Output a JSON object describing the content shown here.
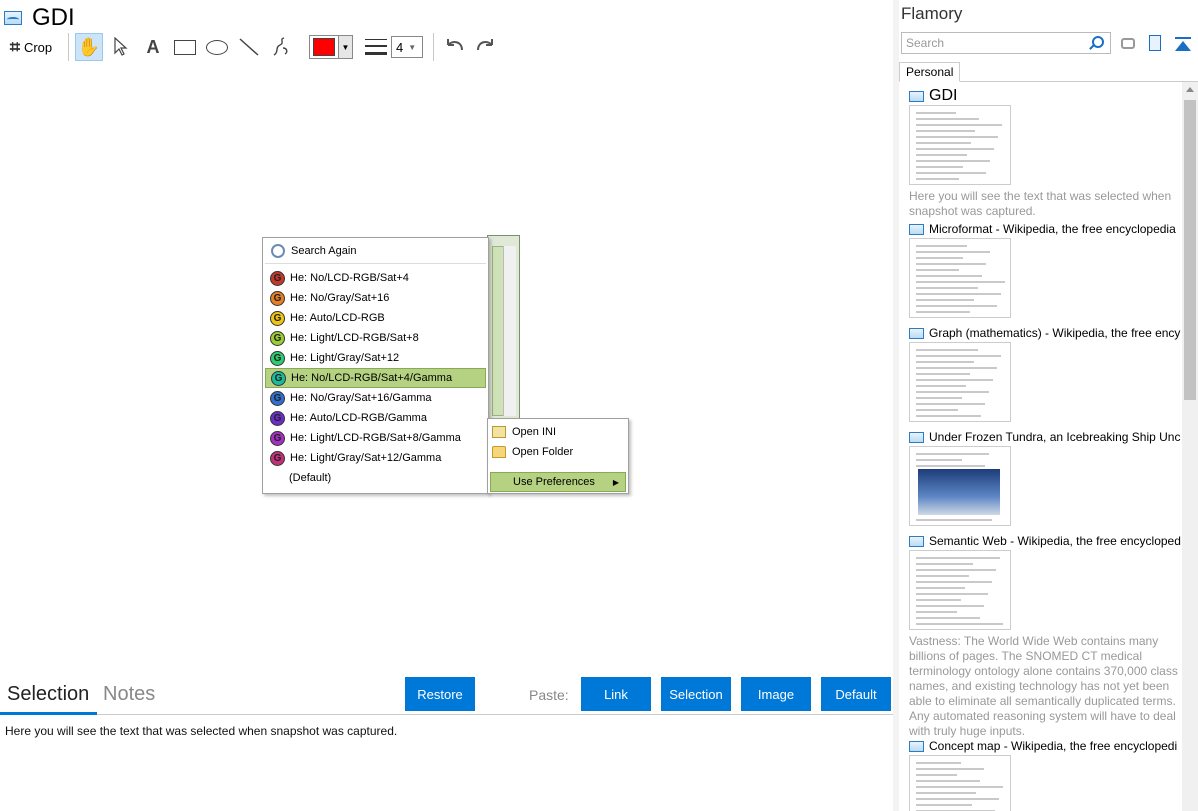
{
  "window": {
    "title": "GDI"
  },
  "toolbar": {
    "crop_label": "Crop",
    "color": "#ff0000",
    "line_width": "4"
  },
  "context_menu": {
    "search_again": "Search Again",
    "items": [
      {
        "label": "He: No/LCD-RGB/Sat+4",
        "color": "#c0392b"
      },
      {
        "label": "He: No/Gray/Sat+16",
        "color": "#e67e22"
      },
      {
        "label": "He: Auto/LCD-RGB",
        "color": "#f1c40f"
      },
      {
        "label": "He: Light/LCD-RGB/Sat+8",
        "color": "#9acd32"
      },
      {
        "label": "He: Light/Gray/Sat+12",
        "color": "#2ecc71"
      },
      {
        "label": "He: No/LCD-RGB/Sat+4/Gamma",
        "color": "#1abc9c"
      },
      {
        "label": "He: No/Gray/Sat+16/Gamma",
        "color": "#2e6fd0"
      },
      {
        "label": "He: Auto/LCD-RGB/Gamma",
        "color": "#6a2ec7"
      },
      {
        "label": "He: Light/LCD-RGB/Sat+8/Gamma",
        "color": "#a330c2"
      },
      {
        "label": "He: Light/Gray/Sat+12/Gamma",
        "color": "#c2307a"
      }
    ],
    "default_label": "(Default)",
    "submenu": {
      "open_ini": "Open INI",
      "open_folder": "Open Folder",
      "use_preferences": "Use Preferences"
    }
  },
  "bottom": {
    "tab_selection": "Selection",
    "tab_notes": "Notes",
    "restore": "Restore",
    "paste_label": "Paste:",
    "paste_link": "Link",
    "paste_selection": "Selection",
    "paste_image": "Image",
    "paste_default": "Default",
    "selection_text": "Here you will see the text that was selected when snapshot was captured."
  },
  "sidebar": {
    "title": "Flamory",
    "search_placeholder": "Search",
    "tab_personal": "Personal",
    "entries": [
      {
        "title": "GDI",
        "desc": "Here you will see the text that was selected when snapshot was captured."
      },
      {
        "title": "Microformat - Wikipedia, the free encyclopedia",
        "desc": ""
      },
      {
        "title": "Graph (mathematics) - Wikipedia, the free ency",
        "desc": ""
      },
      {
        "title": "Under Frozen Tundra, an Icebreaking Ship Unco",
        "desc": ""
      },
      {
        "title": "Semantic Web - Wikipedia, the free encycloped",
        "desc": "Vastness: The World Wide Web contains many billions of pages. The SNOMED CT medical terminology ontology alone contains 370,000 class names, and existing technology has not yet been able to eliminate all semantically duplicated terms. Any automated reasoning system will have to deal with truly huge inputs."
      },
      {
        "title": "Concept map - Wikipedia, the free encyclopedi",
        "desc": ""
      }
    ]
  }
}
